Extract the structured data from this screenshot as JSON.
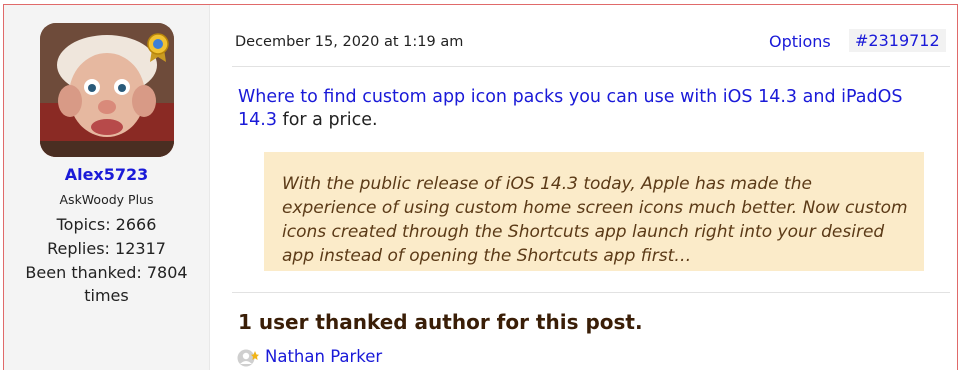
{
  "author": {
    "username": "Alex5723",
    "role": "AskWoody Plus",
    "topics": "Topics: 2666",
    "replies": "Replies: 12317",
    "thanked_line1": "Been thanked: 7804",
    "thanked_line2": "times"
  },
  "post": {
    "date": "December 15, 2020 at 1:19 am",
    "options_label": "Options",
    "post_number": "#2319712",
    "link_text": "Where to find custom app icon packs you can use with iOS 14.3 and iPadOS 14.3",
    "after_link_text": " for a price.",
    "quote": "With the public release of iOS 14.3 today, Apple has made the experience of using custom home screen icons much better. Now custom icons created through the Shortcuts app launch right into your desired app instead of opening the Shortcuts app first…"
  },
  "thanks": {
    "title": "1 user thanked author for this post.",
    "users": [
      "Nathan Parker"
    ]
  },
  "colors": {
    "link": "#1a1ad8",
    "quote_bg": "#fbebc9",
    "quote_text": "#5b3a17"
  }
}
